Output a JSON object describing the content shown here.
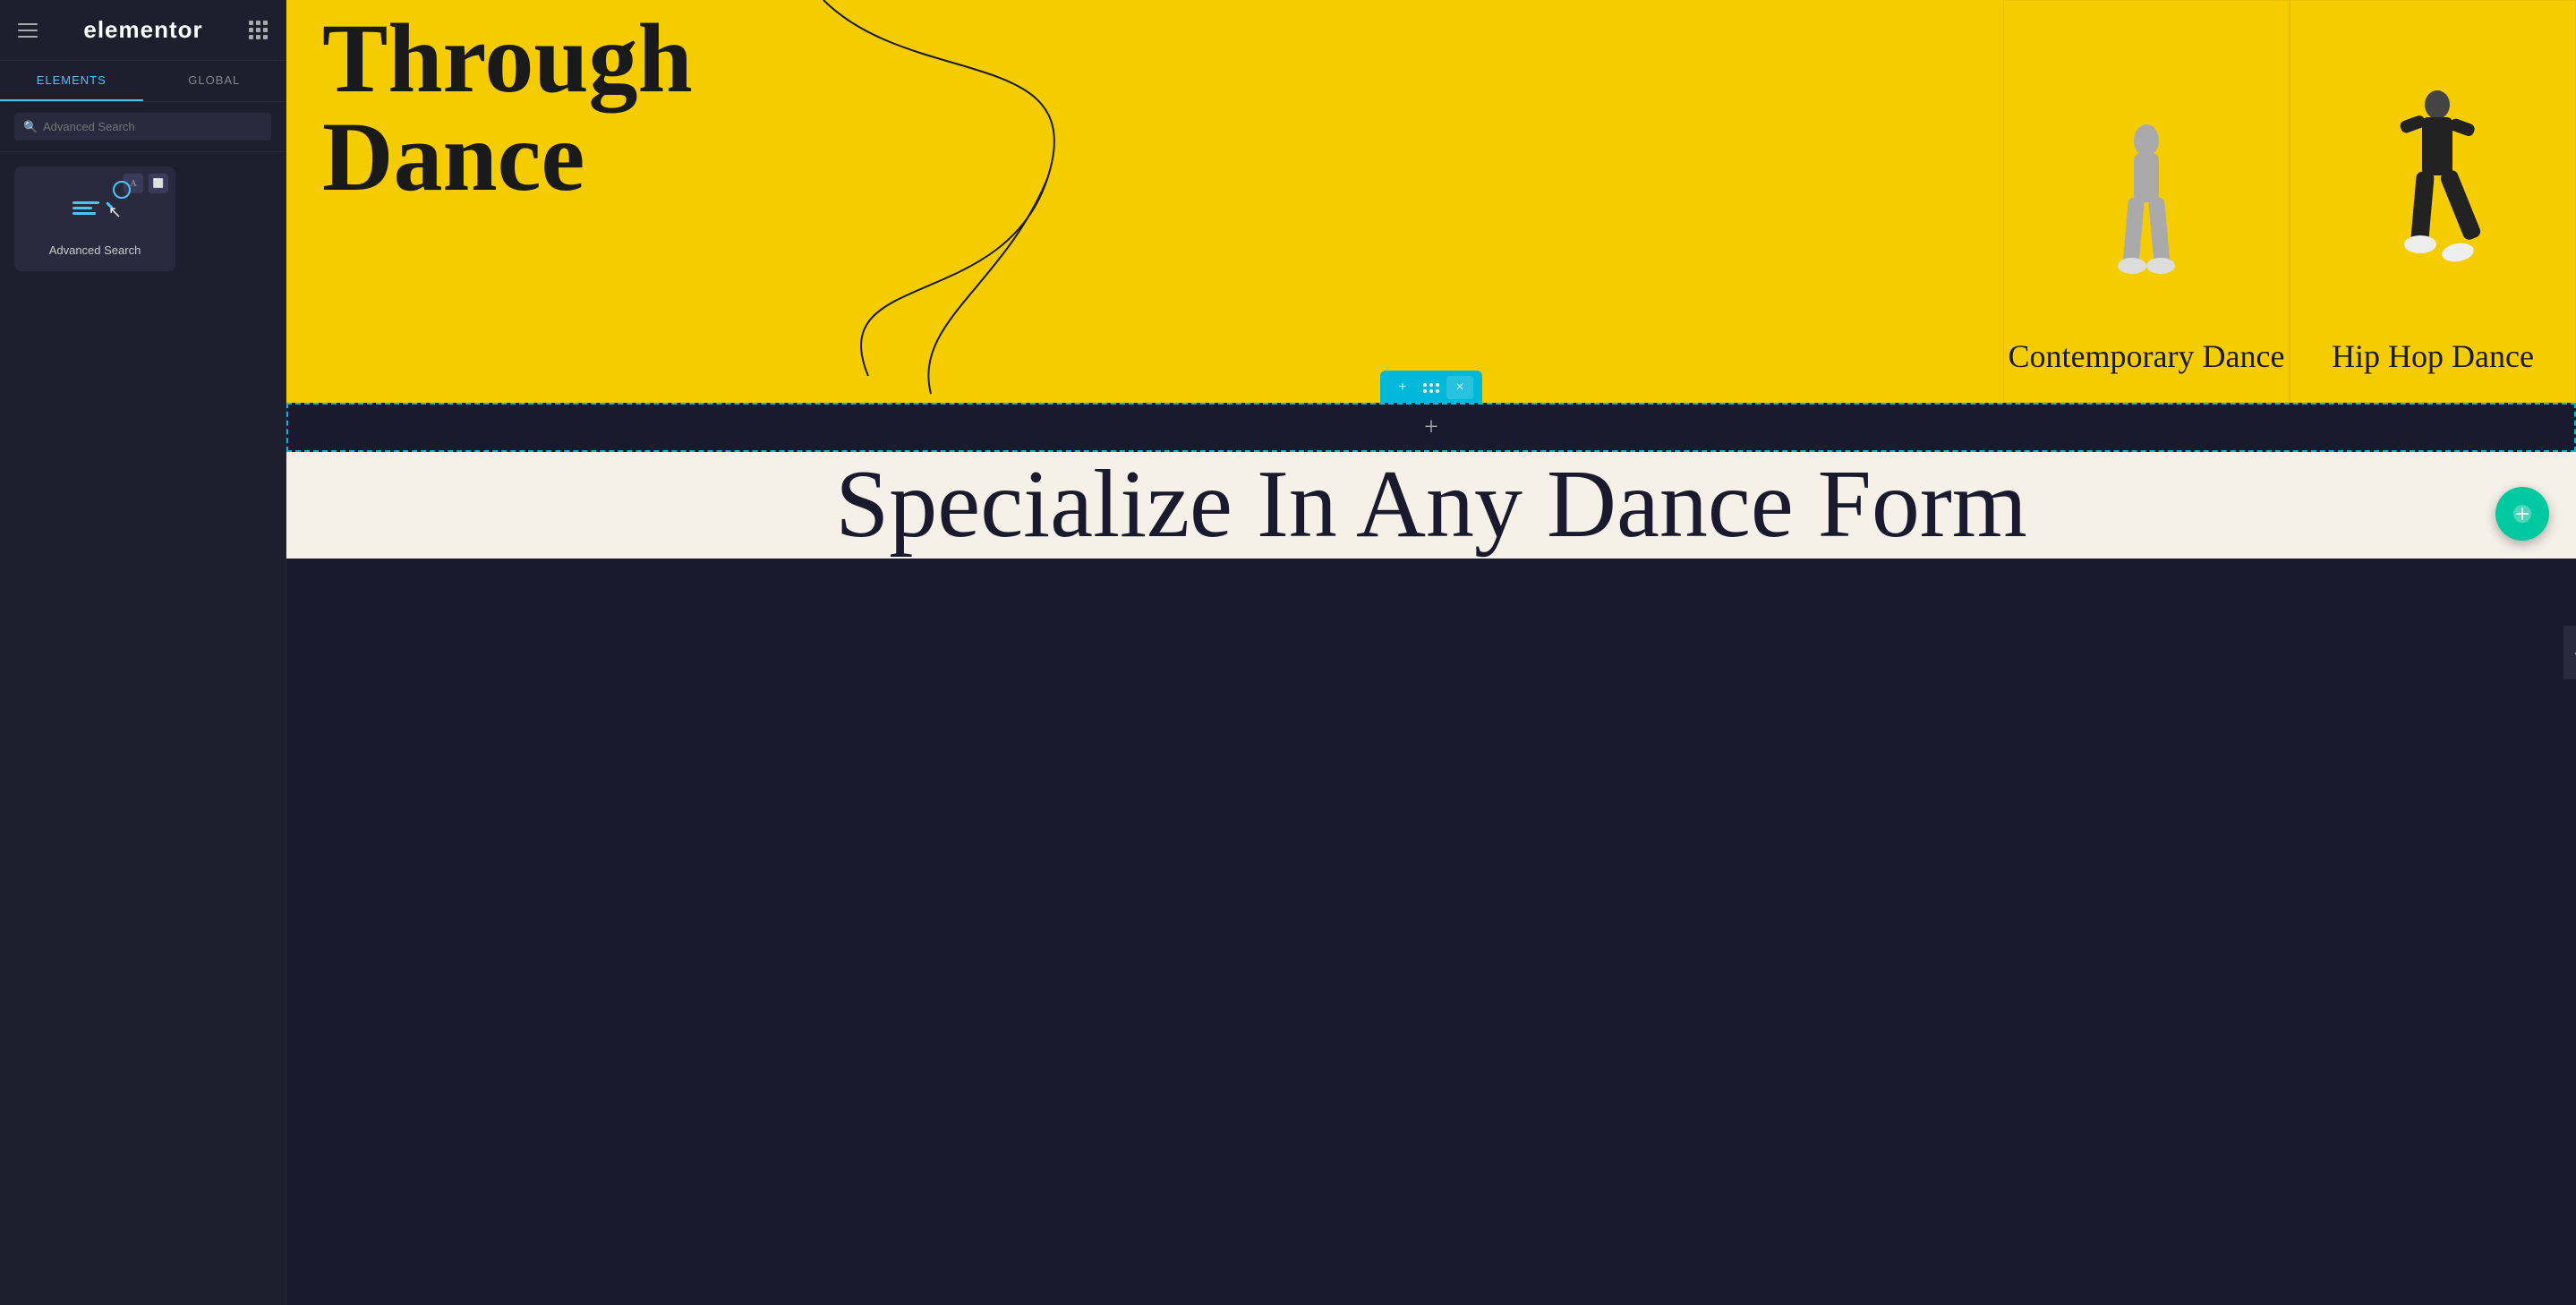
{
  "sidebar": {
    "brand": "elementor",
    "tabs": [
      {
        "label": "ELEMENTS",
        "active": true
      },
      {
        "label": "GLOBAL",
        "active": false
      }
    ],
    "search": {
      "placeholder": "Advanced Search",
      "value": ""
    },
    "widget": {
      "label": "Advanced Search",
      "type": "advanced-search"
    }
  },
  "canvas": {
    "yellow_section": {
      "title_line1": "Through",
      "title_line2": "Dance"
    },
    "dance_cards": [
      {
        "title": "Contemporary Dance"
      },
      {
        "title": "Hip Hop Dance"
      }
    ],
    "toolbar": {
      "add": "+",
      "move": "⠿",
      "close": "×"
    },
    "empty_section_add": "+",
    "cream_section": {
      "title": "Specialize In Any Dance Form"
    }
  }
}
